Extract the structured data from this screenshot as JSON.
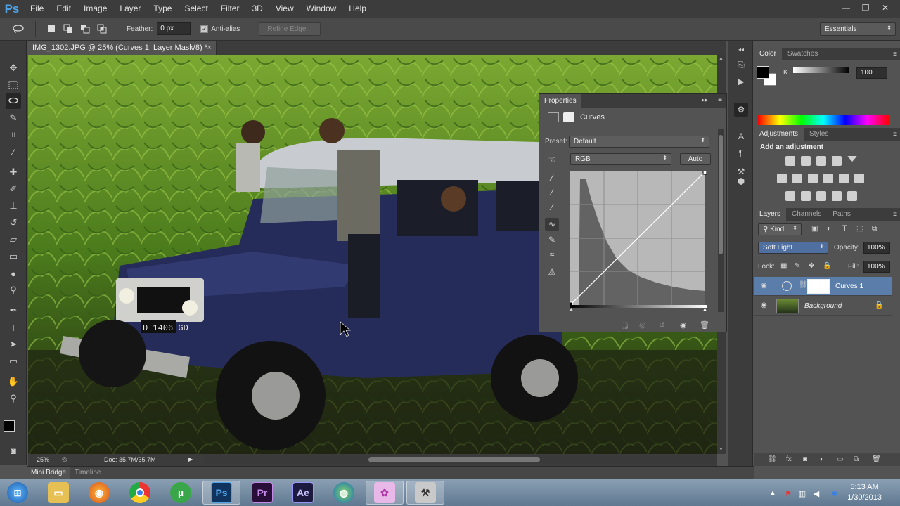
{
  "app": {
    "logo": "Ps"
  },
  "menu": [
    "File",
    "Edit",
    "Image",
    "Layer",
    "Type",
    "Select",
    "Filter",
    "3D",
    "View",
    "Window",
    "Help"
  ],
  "window_controls": {
    "minimize": "—",
    "restore": "❐",
    "close": "✕"
  },
  "options": {
    "feather_label": "Feather:",
    "feather_value": "0 px",
    "antialias_label": "Anti-alias",
    "antialias_checked": true,
    "refine_edge": "Refine Edge...",
    "workspace": "Essentials"
  },
  "document": {
    "tab_title": "IMG_1302.JPG @ 25% (Curves 1, Layer Mask/8) *",
    "tab_close": "×",
    "zoom": "25%",
    "doc_size": "Doc: 35.7M/35.7M",
    "license_plate": "D 1406 GD"
  },
  "bottom_tabs": [
    "Mini Bridge",
    "Timeline"
  ],
  "properties": {
    "title": "Properties",
    "type": "Curves",
    "preset_label": "Preset:",
    "preset_value": "Default",
    "channel": "RGB",
    "auto_button": "Auto",
    "curve": {
      "input": [
        0,
        255
      ],
      "output": [
        0,
        255
      ]
    }
  },
  "color_panel": {
    "tabs": [
      "Color",
      "Swatches"
    ],
    "channel_label": "K",
    "value": "100",
    "foreground": "#000000",
    "background": "#ffffff"
  },
  "adjustments_panel": {
    "tabs": [
      "Adjustments",
      "Styles"
    ],
    "heading": "Add an adjustment"
  },
  "layers_panel": {
    "tabs": [
      "Layers",
      "Channels",
      "Paths"
    ],
    "filter_kind": "Kind",
    "blend_mode": "Soft Light",
    "opacity_label": "Opacity:",
    "opacity": "100%",
    "lock_label": "Lock:",
    "fill_label": "Fill:",
    "fill": "100%",
    "layers": [
      {
        "name": "Curves 1",
        "selected": true
      },
      {
        "name": "Background",
        "locked": true
      }
    ]
  },
  "taskbar": {
    "time": "5:13 AM",
    "date": "1/30/2013",
    "apps": [
      "windows-explorer",
      "firefox",
      "chrome",
      "utorrent",
      "photoshop",
      "premiere",
      "after-effects",
      "globe",
      "paint",
      "tools"
    ],
    "app_letters": {
      "photoshop": "Ps",
      "premiere": "Pr",
      "after-effects": "Ae"
    }
  },
  "colors": {
    "menubar": "#3c3c3c",
    "panel": "#535353",
    "selection": "#5b7daa",
    "accent": "#4fa3e8"
  }
}
